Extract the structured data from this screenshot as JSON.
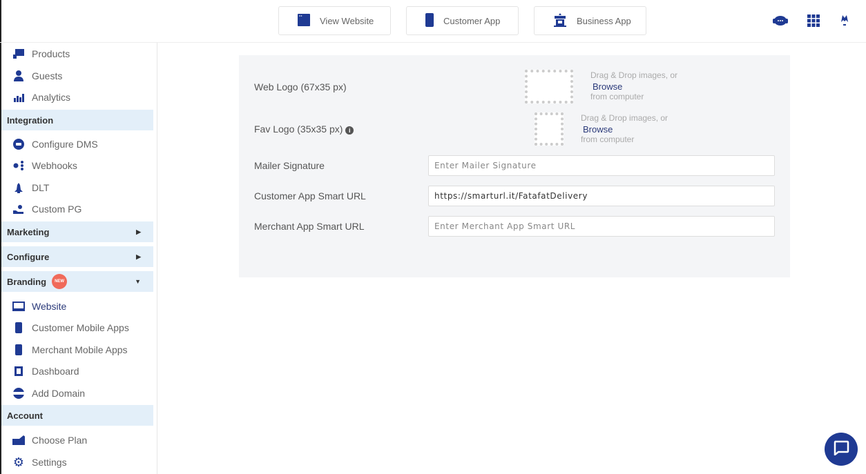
{
  "topbar": {
    "view_website": "View Website",
    "customer_app": "Customer App",
    "business_app": "Business App"
  },
  "sidebar": {
    "items_top": [
      "Products",
      "Guests",
      "Analytics"
    ],
    "integration": {
      "header": "Integration",
      "items": [
        "Configure DMS",
        "Webhooks",
        "DLT",
        "Custom PG"
      ]
    },
    "marketing": "Marketing",
    "configure": "Configure",
    "branding": {
      "header": "Branding",
      "badge": "NEW",
      "items": [
        "Website",
        "Customer Mobile Apps",
        "Merchant Mobile Apps",
        "Dashboard",
        "Add Domain"
      ]
    },
    "account": {
      "header": "Account",
      "items": [
        "Choose Plan",
        "Settings"
      ]
    }
  },
  "form": {
    "web_logo": "Web Logo (67x35 px)",
    "fav_logo": "Fav Logo (35x35 px)",
    "drop_text": "Drag & Drop images, or",
    "browse": "Browse",
    "from_computer": "from computer",
    "mailer_label": "Mailer Signature",
    "mailer_placeholder": "Enter Mailer Signature",
    "customer_url_label": "Customer App Smart URL",
    "customer_url_value": "https://smarturl.it/FatafatDelivery",
    "merchant_url_label": "Merchant App Smart URL",
    "merchant_url_placeholder": "Enter Merchant App Smart URL"
  },
  "colors": {
    "accent": "#1f3a93",
    "section_bg": "#e3eff9",
    "badge": "#f06a5a",
    "panel_bg": "#f4f5f7"
  }
}
